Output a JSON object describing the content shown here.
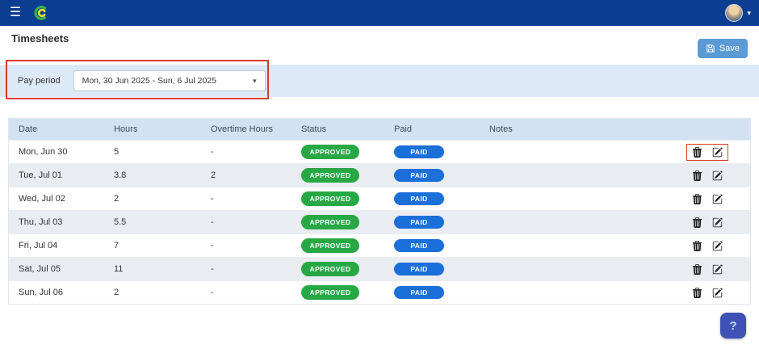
{
  "icons": {
    "menu": "☰",
    "chevron": "▾",
    "caret": "▾"
  },
  "header": {
    "title": "Timesheets",
    "save_label": "Save"
  },
  "filters": {
    "label": "Pay period",
    "value": "Mon, 30 Jun 2025 - Sun, 6 Jul 2025"
  },
  "table": {
    "columns": [
      "Date",
      "Hours",
      "Overtime Hours",
      "Status",
      "Paid",
      "Notes",
      ""
    ],
    "rows": [
      {
        "date": "Mon, Jun 30",
        "hours": "5",
        "overtime": "-",
        "status": "APPROVED",
        "paid": "PAID",
        "notes": ""
      },
      {
        "date": "Tue, Jul 01",
        "hours": "3.8",
        "overtime": "2",
        "status": "APPROVED",
        "paid": "PAID",
        "notes": ""
      },
      {
        "date": "Wed, Jul 02",
        "hours": "2",
        "overtime": "-",
        "status": "APPROVED",
        "paid": "PAID",
        "notes": ""
      },
      {
        "date": "Thu, Jul 03",
        "hours": "5.5",
        "overtime": "-",
        "status": "APPROVED",
        "paid": "PAID",
        "notes": ""
      },
      {
        "date": "Fri, Jul 04",
        "hours": "7",
        "overtime": "-",
        "status": "APPROVED",
        "paid": "PAID",
        "notes": ""
      },
      {
        "date": "Sat, Jul 05",
        "hours": "11",
        "overtime": "-",
        "status": "APPROVED",
        "paid": "PAID",
        "notes": ""
      },
      {
        "date": "Sun, Jul 06",
        "hours": "2",
        "overtime": "-",
        "status": "APPROVED",
        "paid": "PAID",
        "notes": ""
      }
    ]
  },
  "annotations": {
    "pay_period_box": true,
    "row_actions_annotated_index": 0
  },
  "help": {
    "label": "?"
  },
  "colors": {
    "navbar": "#0b3d91",
    "save": "#5b9bd5",
    "band": "#dce9f7",
    "header_row": "#d2e2f2",
    "alt_row": "#e9edf2",
    "approved": "#28a745",
    "paid": "#1b6fd8",
    "annotation": "#d93a2b",
    "help": "#3f51b5",
    "logo_green": "#3db54a",
    "logo_yellow": "#e8e23b"
  }
}
